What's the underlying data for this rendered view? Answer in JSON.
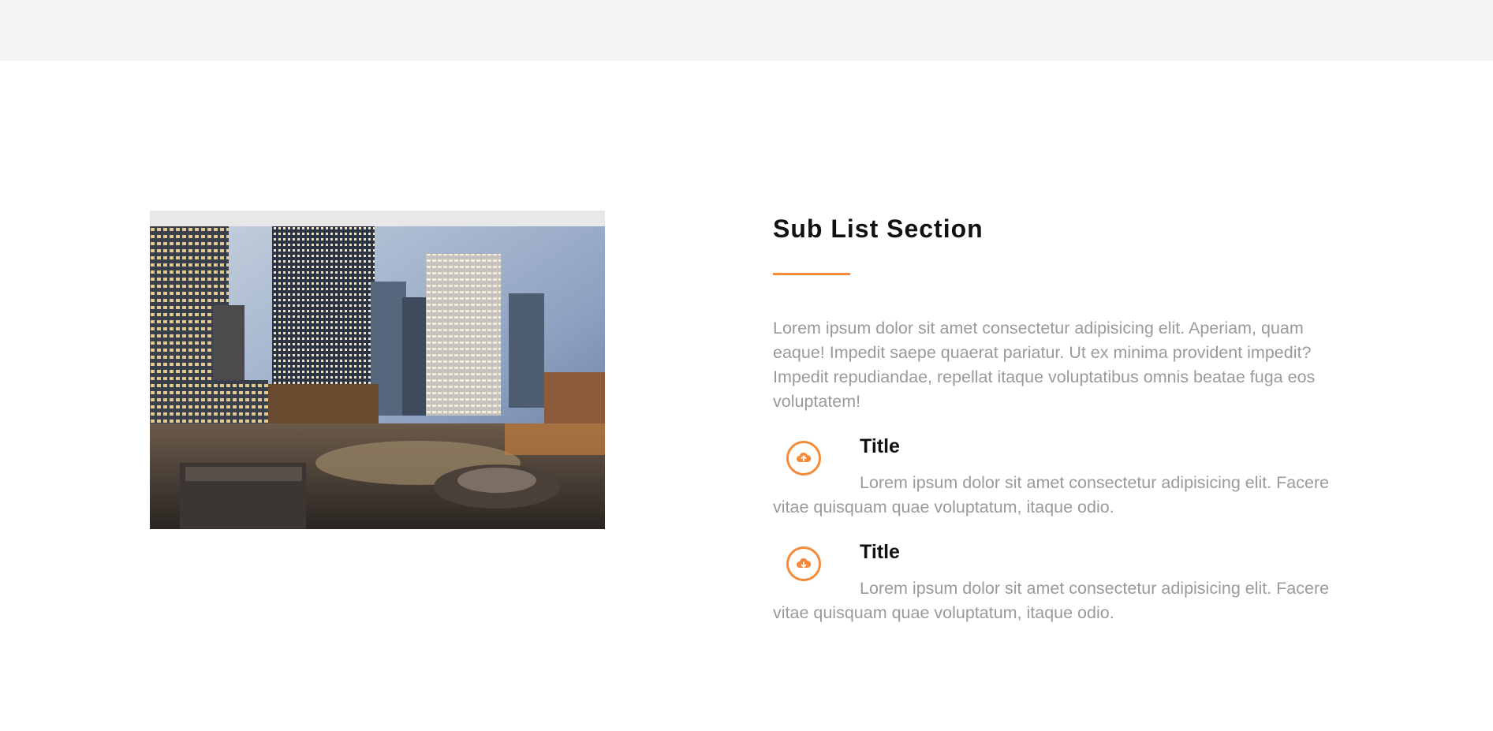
{
  "header": {},
  "image": {
    "alt_name": "city-skyline-photo"
  },
  "section": {
    "title": "Sub List Section",
    "intro": "Lorem ipsum dolor sit amet consectetur adipisicing elit. Aperiam, quam eaque! Impedit saepe quaerat pariatur. Ut ex minima provident impedit? Impedit repudiandae, repellat itaque voluptatibus omnis beatae fuga eos voluptatem!",
    "items": [
      {
        "icon": "cloud-upload-icon",
        "title": "Title",
        "description": "Lorem ipsum dolor sit amet consectetur adipisicing elit. Facere vitae quisquam quae voluptatum, itaque odio."
      },
      {
        "icon": "cloud-download-icon",
        "title": "Title",
        "description": "Lorem ipsum dolor sit amet consectetur adipisicing elit. Facere vitae quisquam quae voluptatum, itaque odio."
      }
    ]
  },
  "colors": {
    "accent": "#f48a3a",
    "muted_text": "#9a9a9a",
    "topbar": "#f4f4f4"
  }
}
